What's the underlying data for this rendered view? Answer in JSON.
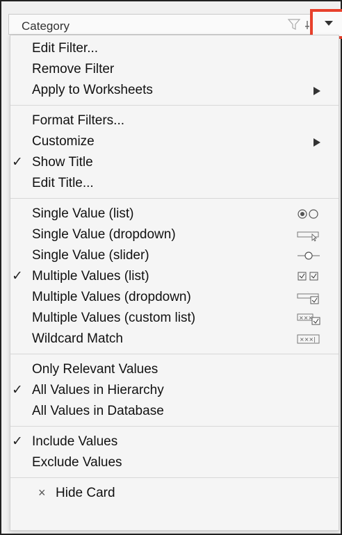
{
  "header": {
    "title": "Category",
    "filter_icon": "funnel-icon",
    "pin_icon": "pin-icon",
    "dropdown_icon": "caret-down-icon"
  },
  "menu": {
    "sections": [
      {
        "items": [
          {
            "label": "Edit Filter...",
            "checked": false,
            "submenu": false
          },
          {
            "label": "Remove Filter",
            "checked": false,
            "submenu": false
          },
          {
            "label": "Apply to Worksheets",
            "checked": false,
            "submenu": true
          }
        ]
      },
      {
        "items": [
          {
            "label": "Format Filters...",
            "checked": false,
            "submenu": false
          },
          {
            "label": "Customize",
            "checked": false,
            "submenu": true
          },
          {
            "label": "Show Title",
            "checked": true,
            "submenu": false
          },
          {
            "label": "Edit Title...",
            "checked": false,
            "submenu": false
          }
        ]
      },
      {
        "items": [
          {
            "label": "Single Value (list)",
            "checked": false,
            "icon": "radio-pair-icon"
          },
          {
            "label": "Single Value (dropdown)",
            "checked": false,
            "icon": "dropdown-select-icon"
          },
          {
            "label": "Single Value (slider)",
            "checked": false,
            "icon": "slider-icon"
          },
          {
            "label": "Multiple Values (list)",
            "checked": true,
            "icon": "checkbox-pair-icon"
          },
          {
            "label": "Multiple Values (dropdown)",
            "checked": false,
            "icon": "dropdown-checkbox-icon"
          },
          {
            "label": "Multiple Values (custom list)",
            "checked": false,
            "icon": "custom-list-icon"
          },
          {
            "label": "Wildcard Match",
            "checked": false,
            "icon": "wildcard-field-icon"
          }
        ]
      },
      {
        "items": [
          {
            "label": "Only Relevant Values",
            "checked": false
          },
          {
            "label": "All Values in Hierarchy",
            "checked": true
          },
          {
            "label": "All Values in Database",
            "checked": false
          }
        ]
      },
      {
        "items": [
          {
            "label": "Include Values",
            "checked": true
          },
          {
            "label": "Exclude Values",
            "checked": false
          }
        ]
      },
      {
        "items": [
          {
            "label": "Hide Card",
            "checked": false,
            "prefix": "×"
          }
        ]
      }
    ],
    "check_glyph": "✓",
    "icon_text": {
      "custom_list": "×××",
      "wildcard": "×××|"
    },
    "colors": {
      "highlight_border": "#e8412c",
      "icon_gray": "#777777"
    }
  }
}
